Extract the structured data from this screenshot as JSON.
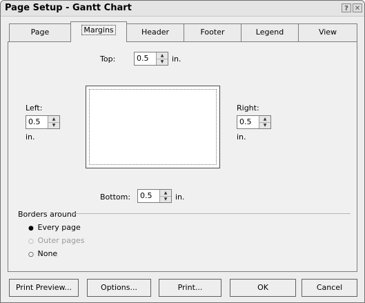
{
  "window": {
    "title": "Page Setup - Gantt Chart",
    "help_glyph": "?",
    "close_glyph": "✕"
  },
  "tabs": [
    {
      "label": "Page"
    },
    {
      "label": "Margins"
    },
    {
      "label": "Header"
    },
    {
      "label": "Footer"
    },
    {
      "label": "Legend"
    },
    {
      "label": "View"
    }
  ],
  "margins": {
    "top": {
      "label": "Top:",
      "value": "0.5",
      "unit": "in."
    },
    "left": {
      "label": "Left:",
      "value": "0.5",
      "unit": "in."
    },
    "right": {
      "label": "Right:",
      "value": "0.5",
      "unit": "in."
    },
    "bottom": {
      "label": "Bottom:",
      "value": "0.5",
      "unit": "in."
    }
  },
  "borders": {
    "title": "Borders around",
    "options": [
      {
        "label": "Every page",
        "selected": true,
        "enabled": true
      },
      {
        "label": "Outer pages",
        "selected": false,
        "enabled": false
      },
      {
        "label": "None",
        "selected": false,
        "enabled": true
      }
    ]
  },
  "buttons": {
    "print_preview": "Print Preview...",
    "options": "Options...",
    "print": "Print...",
    "ok": "OK",
    "cancel": "Cancel"
  }
}
